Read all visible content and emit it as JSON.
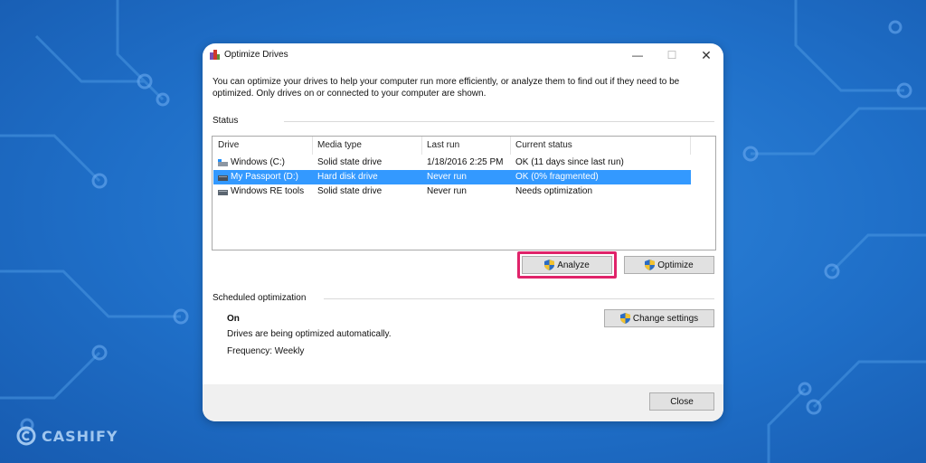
{
  "window": {
    "title": "Optimize Drives",
    "minimize_glyph": "—",
    "maximize_glyph": "☐",
    "close_glyph": "✕"
  },
  "intro_text": "You can optimize your drives to help your computer run more efficiently, or analyze them to find out if they need to be optimized. Only drives on or connected to your computer are shown.",
  "status": {
    "label": "Status",
    "columns": [
      "Drive",
      "Media type",
      "Last run",
      "Current status"
    ],
    "rows": [
      {
        "drive": "Windows (C:)",
        "media": "Solid state drive",
        "last_run": "1/18/2016 2:25 PM",
        "status": "OK (11 days since last run)",
        "icon": "windows-drive-icon",
        "selected": false
      },
      {
        "drive": "My Passport (D:)",
        "media": "Hard disk drive",
        "last_run": "Never run",
        "status": "OK (0% fragmented)",
        "icon": "external-drive-icon",
        "selected": true
      },
      {
        "drive": "Windows RE tools",
        "media": "Solid state drive",
        "last_run": "Never run",
        "status": "Needs optimization",
        "icon": "drive-icon",
        "selected": false
      }
    ],
    "analyze_label": "Analyze",
    "optimize_label": "Optimize"
  },
  "scheduled": {
    "label": "Scheduled optimization",
    "state": "On",
    "description": "Drives are being optimized automatically.",
    "frequency": "Frequency: Weekly",
    "change_label": "Change settings"
  },
  "footer": {
    "close_label": "Close"
  },
  "watermark": {
    "brand": "CASHIFY"
  },
  "colors": {
    "selection": "#3399ff",
    "highlight_border": "#e0236a",
    "background": "#2277d0"
  },
  "icons": {
    "app": "defrag-icon",
    "shield": "uac-shield-icon"
  }
}
